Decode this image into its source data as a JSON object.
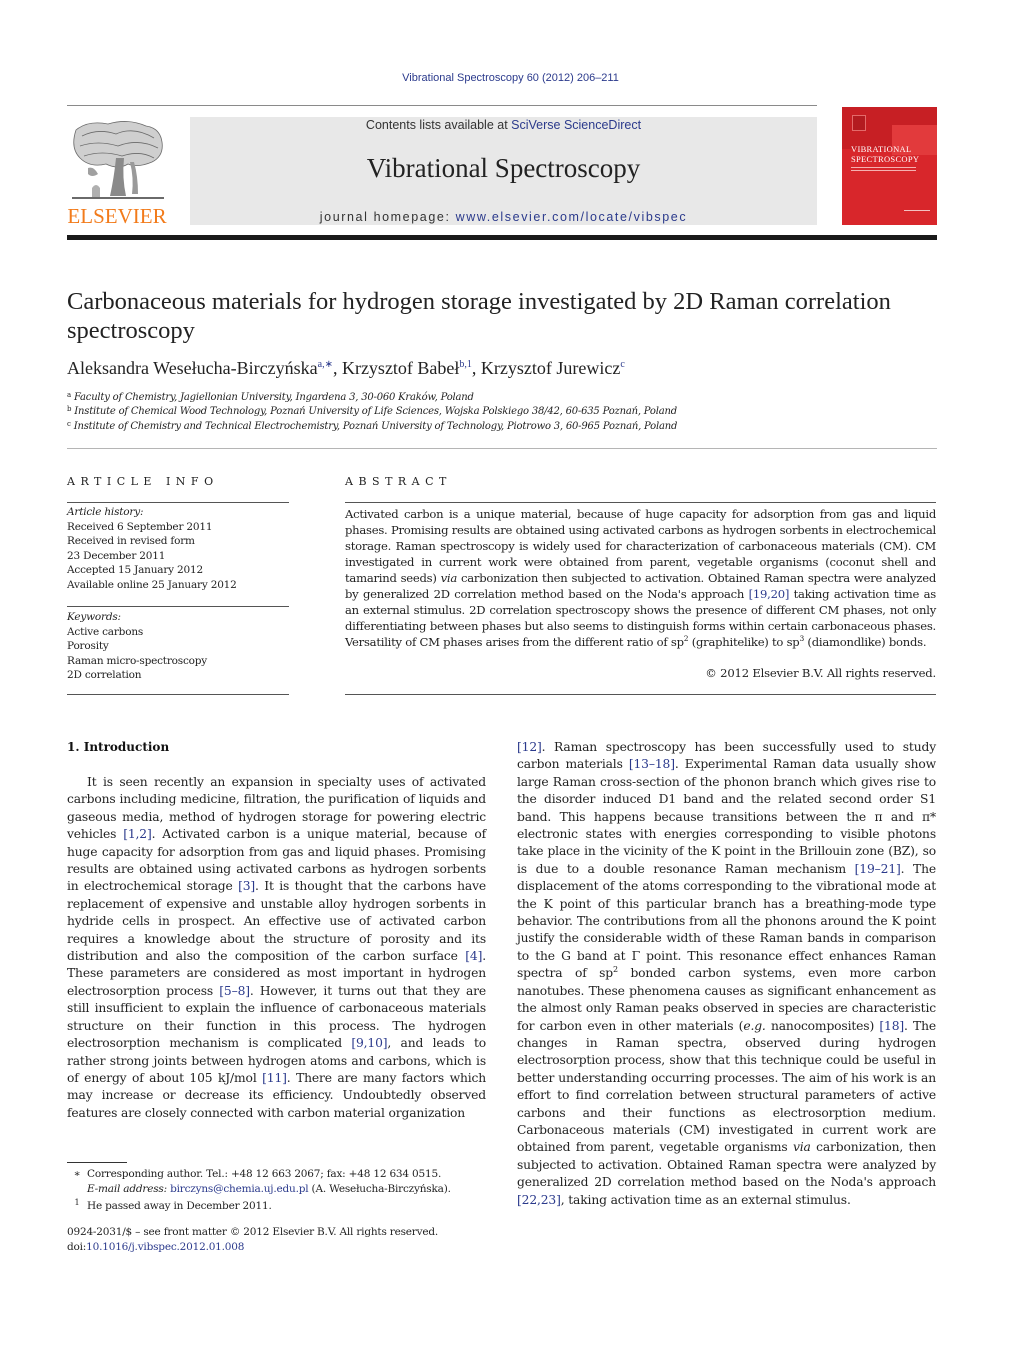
{
  "header": {
    "running_head": "Vibrational Spectroscopy 60 (2012) 206–211",
    "contents_prefix": "Contents lists available at ",
    "contents_link": "SciVerse ScienceDirect",
    "journal_title": "Vibrational Spectroscopy",
    "homepage_prefix": "journal homepage: ",
    "homepage_link": "www.elsevier.com/locate/vibspec",
    "publisher_logo_text": "ELSEVIER",
    "cover_title_line1": "VIBRATIONAL",
    "cover_title_line2": "SPECTROSCOPY",
    "colors": {
      "publisher_orange": "#f27b1b",
      "cover_red": "#d8262b",
      "banner_gray": "#e8e8e8",
      "link_blue": "#2b3a8c"
    }
  },
  "article": {
    "title": "Carbonaceous materials for hydrogen storage investigated by 2D Raman correlation spectroscopy",
    "authors": [
      {
        "name": "Aleksandra Wesełucha-Birczyńska",
        "sup": "a,∗",
        "sep": ", "
      },
      {
        "name": "Krzysztof Babeł",
        "sup": "b,1",
        "sep": ", "
      },
      {
        "name": "Krzysztof Jurewicz",
        "sup": "c",
        "sep": ""
      }
    ],
    "affiliations": [
      {
        "mark": "a",
        "text": "Faculty of Chemistry, Jagiellonian University, Ingardena 3, 30-060 Kraków, Poland"
      },
      {
        "mark": "b",
        "text": "Institute of Chemical Wood Technology, Poznań University of Life Sciences, Wojska Polskiego 38/42, 60-635 Poznań, Poland"
      },
      {
        "mark": "c",
        "text": "Institute of Chemistry and Technical Electrochemistry, Poznań University of Technology, Piotrowo 3, 60-965 Poznań, Poland"
      }
    ]
  },
  "article_info": {
    "heading": "ARTICLE INFO",
    "history_label": "Article history:",
    "history": [
      "Received 6 September 2011",
      "Received in revised form",
      "23 December 2011",
      "Accepted 15 January 2012",
      "Available online 25 January 2012"
    ],
    "keywords_label": "Keywords:",
    "keywords": [
      "Active carbons",
      "Porosity",
      "Raman micro-spectroscopy",
      "2D correlation"
    ]
  },
  "abstract": {
    "heading": "ABSTRACT",
    "p1": "Activated carbon is a unique material, because of huge capacity for adsorption from gas and liquid phases. Promising results are obtained using activated carbons as hydrogen sorbents in electrochemical storage. Raman spectroscopy is widely used for characterization of carbonaceous materials (CM). CM investigated in current work were obtained from parent, vegetable organisms (coconut shell and tamarind seeds) ",
    "via": "via",
    "p2": " carbonization then subjected to activation. Obtained Raman spectra were analyzed by generalized 2D correlation method based on the Noda's approach ",
    "ref1": "[19,20]",
    "p3": " taking activation time as an external stimulus. 2D correlation spectroscopy shows the presence of different CM phases, not only differentiating between phases but also seems to distinguish forms within certain carbonaceous phases. Versatility of CM phases arises from the different ratio of sp",
    "sup2": "2",
    "p4": " (graphitelike) to sp",
    "sup3": "3",
    "p5": " (diamondlike) bonds.",
    "copyright": "© 2012 Elsevier B.V. All rights reserved."
  },
  "introduction": {
    "heading": "1.  Introduction",
    "left": [
      {
        "t": "It is seen recently an expansion in specialty uses of activated carbons including medicine, filtration, the purification of liquids and gaseous media, method of hydrogen storage for powering electric vehicles "
      },
      {
        "ref": "[1,2]"
      },
      {
        "t": ". Activated carbon is a unique material, because of huge capacity for adsorption from gas and liquid phases. Promising results are obtained using activated carbons as hydrogen sorbents in electrochemical storage "
      },
      {
        "ref": "[3]"
      },
      {
        "t": ". It is thought that the carbons have replacement of expensive and unstable alloy hydrogen sorbents in hydride cells in prospect. An effective use of activated carbon requires a knowledge about the structure of porosity and its distribution and also the composition of the carbon surface "
      },
      {
        "ref": "[4]"
      },
      {
        "t": ". These parameters are considered as most important in hydrogen electrosorption process "
      },
      {
        "ref": "[5–8]"
      },
      {
        "t": ". However, it turns out that they are still insufficient to explain the influence of carbonaceous materials structure on their function in this process. The hydrogen electrosorption mechanism is complicated "
      },
      {
        "ref": "[9,10]"
      },
      {
        "t": ", and leads to rather strong joints between hydrogen atoms and carbons, which is of energy of about 105 kJ/mol "
      },
      {
        "ref": "[11]"
      },
      {
        "t": ". There are many factors which may increase or decrease its efficiency. Undoubtedly observed features are closely connected with carbon material organization"
      }
    ],
    "right": [
      {
        "ref": "[12]"
      },
      {
        "t": ". Raman spectroscopy has been successfully used to study carbon materials "
      },
      {
        "ref": "[13–18]"
      },
      {
        "t": ". Experimental Raman data usually show large Raman cross-section of the phonon branch which gives rise to the disorder induced D1 band and the related second order S1 band. This happens because transitions between the π and π* electronic states with energies corresponding to visible photons take place in the vicinity of the K point in the Brillouin zone (BZ), so is due to a double resonance Raman mechanism "
      },
      {
        "ref": "[19–21]"
      },
      {
        "t": ". The displacement of the atoms corresponding to the vibrational mode at the K point of this particular branch has a breathing-mode type behavior. The contributions from all the phonons around the K point justify the considerable width of these Raman bands in comparison to the G band at Γ point. This resonance effect enhances Raman spectra of sp"
      },
      {
        "sup": "2"
      },
      {
        "t": " bonded carbon systems, even more carbon nanotubes. These phenomena causes as significant enhancement as the almost only Raman peaks observed in species are characteristic for carbon even in other materials ("
      },
      {
        "i": "e.g."
      },
      {
        "t": " nanocomposites) "
      },
      {
        "ref": "[18]"
      },
      {
        "t": ". The changes in Raman spectra, observed during hydrogen electrosorption process, show that this technique could be useful in better understanding occurring processes. The aim of his work is an effort to find correlation between structural parameters of active carbons and their functions as electrosorption medium. Carbonaceous materials (CM) investigated in current work are obtained from parent, vegetable organisms "
      },
      {
        "i": "via"
      },
      {
        "t": " carbonization, then subjected to activation. Obtained Raman spectra were analyzed by generalized 2D correlation method based on the Noda's approach "
      },
      {
        "ref": "[22,23]"
      },
      {
        "t": ", taking activation time as an external stimulus."
      }
    ]
  },
  "footnotes": {
    "corresponding_mark": "∗",
    "corresponding_text": "Corresponding author. Tel.: +48 12 663 2067; fax: +48 12 634 0515.",
    "email_label": "E-mail address: ",
    "email": "birczyns@chemia.uj.edu.pl",
    "email_suffix": " (A. Wesełucha-Birczyńska).",
    "note1_mark": "1",
    "note1_text": "He passed away in December 2011."
  },
  "front_matter": {
    "line1": "0924-2031/$ – see front matter © 2012 Elsevier B.V. All rights reserved.",
    "doi_prefix": "doi:",
    "doi": "10.1016/j.vibspec.2012.01.008"
  }
}
